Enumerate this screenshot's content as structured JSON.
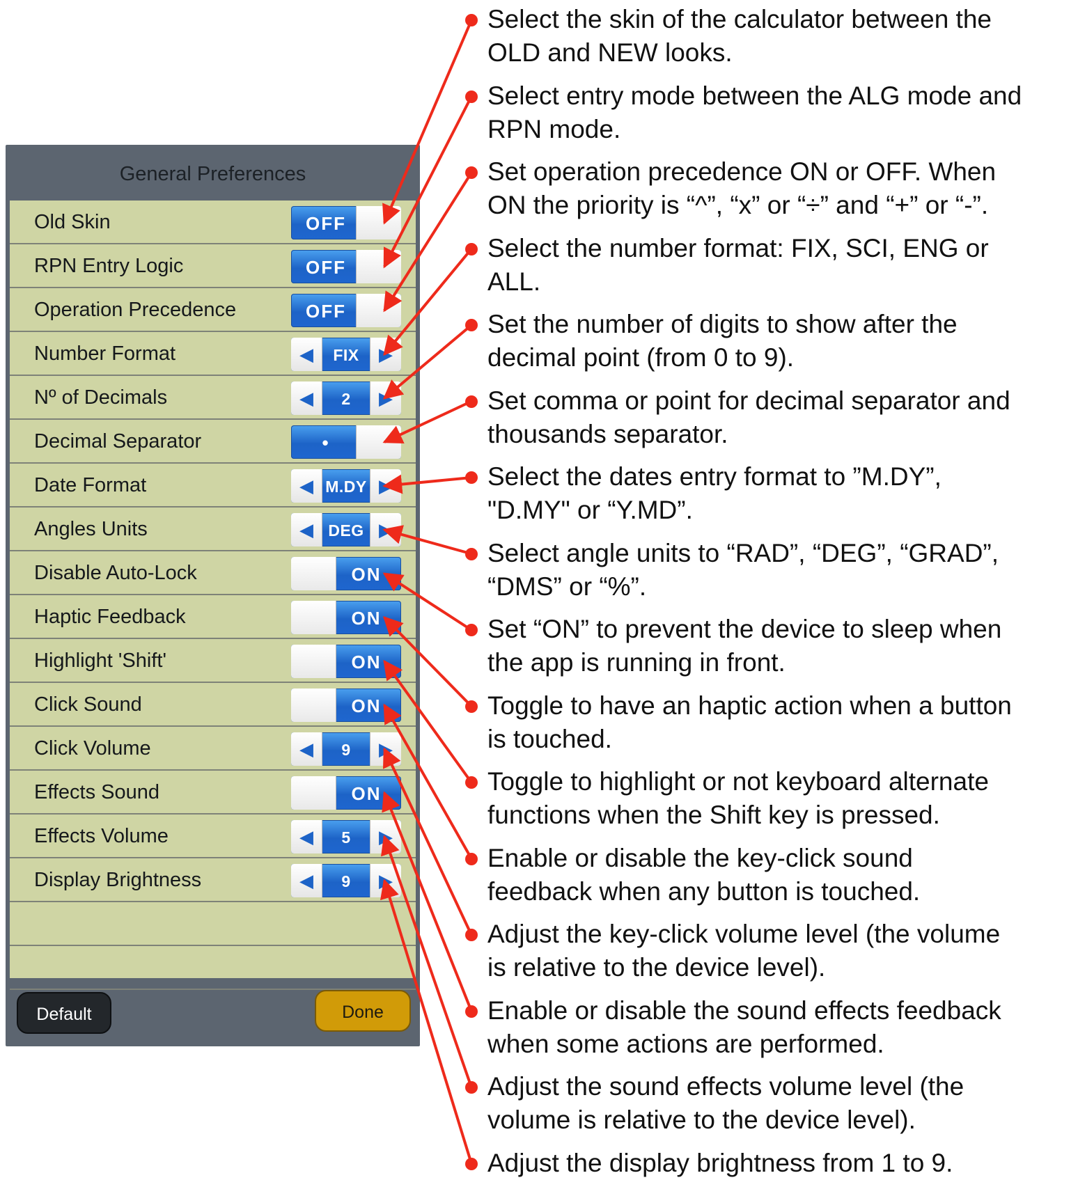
{
  "panel": {
    "title": "General Preferences",
    "rows": [
      {
        "label": "Old Skin",
        "control": "toggle",
        "state": "off",
        "text": "OFF"
      },
      {
        "label": "RPN Entry Logic",
        "control": "toggle",
        "state": "off",
        "text": "OFF"
      },
      {
        "label": "Operation Precedence",
        "control": "toggle",
        "state": "off",
        "text": "OFF"
      },
      {
        "label": "Number Format",
        "control": "stepper",
        "text": "FIX"
      },
      {
        "label": "Nº of Decimals",
        "control": "stepper",
        "text": "2"
      },
      {
        "label": "Decimal Separator",
        "control": "toggle",
        "state": "off",
        "text": "•"
      },
      {
        "label": "Date Format",
        "control": "stepper",
        "text": "M.DY"
      },
      {
        "label": "Angles Units",
        "control": "stepper",
        "text": "DEG"
      },
      {
        "label": "Disable Auto-Lock",
        "control": "toggle",
        "state": "on",
        "text": "ON"
      },
      {
        "label": "Haptic Feedback",
        "control": "toggle",
        "state": "on",
        "text": "ON"
      },
      {
        "label": "Highlight 'Shift'",
        "control": "toggle",
        "state": "on",
        "text": "ON"
      },
      {
        "label": "Click Sound",
        "control": "toggle",
        "state": "on",
        "text": "ON"
      },
      {
        "label": "Click Volume",
        "control": "stepper",
        "text": "9"
      },
      {
        "label": "Effects Sound",
        "control": "toggle",
        "state": "on",
        "text": "ON"
      },
      {
        "label": "Effects Volume",
        "control": "stepper",
        "text": "5"
      },
      {
        "label": "Display Brightness",
        "control": "stepper",
        "text": "9"
      }
    ],
    "default_label": "Default",
    "done_label": "Done"
  },
  "annotations": [
    {
      "line1": "Select the skin of the calculator between the",
      "line2": "OLD and NEW looks."
    },
    {
      "line1": "Select entry mode between the ALG mode and",
      "line2": "RPN mode."
    },
    {
      "line1": "Set operation precedence ON or OFF. When",
      "line2": "ON the priority is “^”, “x” or “÷” and “+” or “-”."
    },
    {
      "line1": "Select the number format: FIX, SCI, ENG or",
      "line2": "ALL."
    },
    {
      "line1": "Set the number of digits to show after the",
      "line2": "decimal point (from 0 to 9)."
    },
    {
      "line1": "Set comma or point for decimal separator and",
      "line2": "thousands separator."
    },
    {
      "line1": "Select the dates entry format to ”M.DY”,",
      "line2": "\"D.MY\" or “Y.MD”."
    },
    {
      "line1": "Select angle units to “RAD”, “DEG”, “GRAD”,",
      "line2": "“DMS” or “%”."
    },
    {
      "line1": "Set “ON” to prevent the device  to sleep when",
      "line2": "the app is running in front."
    },
    {
      "line1": "Toggle to have an haptic action when a button",
      "line2": "is touched."
    },
    {
      "line1": "Toggle to highlight or not keyboard alternate",
      "line2": "functions when the Shift key is pressed."
    },
    {
      "line1": "Enable or disable the key-click sound",
      "line2": "feedback when any button is touched."
    },
    {
      "line1": "Adjust the key-click volume level (the volume",
      "line2": "is relative to the device level)."
    },
    {
      "line1": "Enable or disable the sound effects feedback",
      "line2": "when some actions are performed."
    },
    {
      "line1": "Adjust the sound effects volume level (the",
      "line2": "volume is relative to the device level)."
    },
    {
      "line1": "Adjust the display brightness from 1 to 9.",
      "line2": ""
    }
  ],
  "colors": {
    "accent_blue": "#1d63c7",
    "row_background": "#cfd5a4",
    "panel_background": "#5c6570",
    "arrow_red": "#ee2a1b",
    "done_button": "#d19b08"
  }
}
